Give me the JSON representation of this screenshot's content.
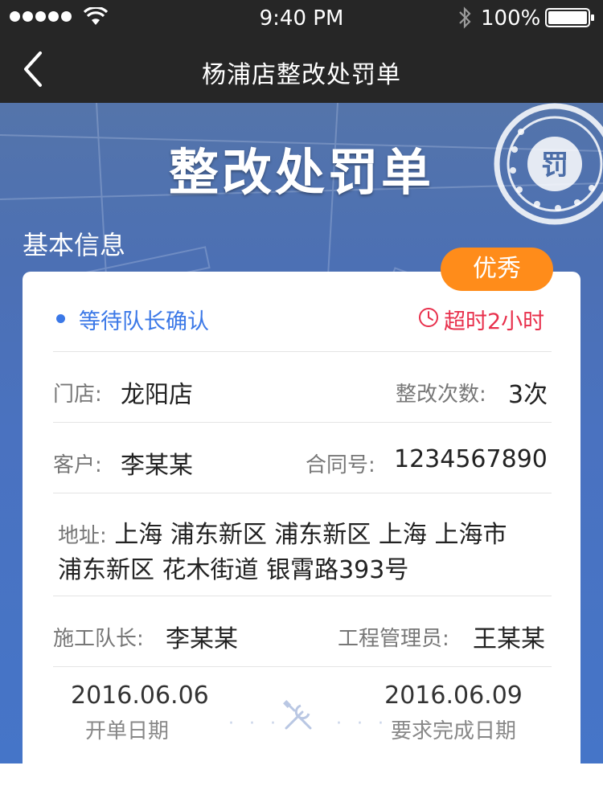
{
  "status_bar": {
    "time": "9:40 PM",
    "battery": "100%",
    "icons": [
      "signal-dots",
      "wifi-icon",
      "bluetooth-icon",
      "battery-icon"
    ]
  },
  "nav": {
    "title": "杨浦店整改处罚单",
    "back_icon": "chevron-left-icon"
  },
  "hero": {
    "title": "整改处罚单",
    "stamp_text": "罚"
  },
  "section": {
    "title": "基本信息"
  },
  "card": {
    "grade": "优秀",
    "status": "等待队长确认",
    "timeout": "超时2小时",
    "store_label": "门店:",
    "store_value": "龙阳店",
    "rectify_label": "整改次数:",
    "rectify_value": "3次",
    "customer_label": "客户:",
    "customer_value": "李某某",
    "contract_label": "合同号:",
    "contract_value": "1234567890",
    "address_label": "地址:",
    "address_line1": "上海 浦东新区 浦东新区 上海 上海市",
    "address_line2": "浦东新区 花木街道 银霄路393号",
    "leader_label": "施工队长:",
    "leader_value": "李某某",
    "manager_label": "工程管理员:",
    "manager_value": "王某某",
    "start_date": "2016.06.06",
    "start_label": "开单日期",
    "due_date": "2016.06.09",
    "due_label": "要求完成日期",
    "dots": "· · ·"
  },
  "colors": {
    "accent_blue": "#3b78e7",
    "warning_red": "#e8304c",
    "badge_orange": "#ff8c1a",
    "header_dark": "#262626"
  }
}
